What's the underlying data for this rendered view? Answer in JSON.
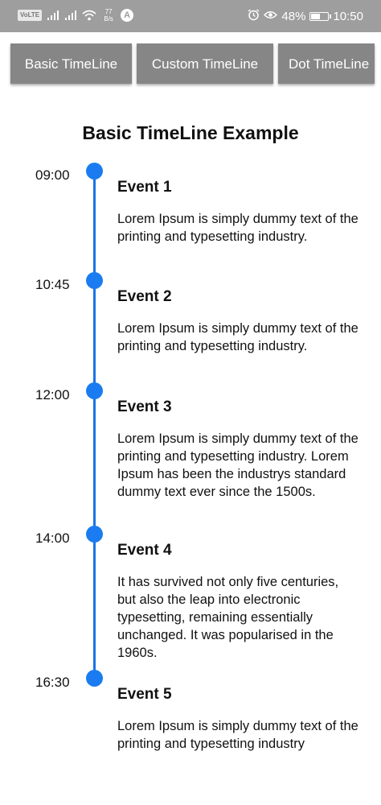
{
  "status_bar": {
    "volte": "VoLTE",
    "net_speed_value": "77",
    "net_speed_unit": "B/s",
    "account_letter": "A",
    "battery": "48%",
    "time": "10:50",
    "icons": [
      "signal-icon",
      "signal-icon",
      "wifi-icon",
      "alarm-icon",
      "eye-icon",
      "battery-icon"
    ]
  },
  "buttons": [
    "Basic TimeLine",
    "Custom TimeLine",
    "Dot TimeLine"
  ],
  "title": "Basic TimeLine Example",
  "accent_color": "#1a7cf0",
  "events": [
    {
      "time": "09:00",
      "title": "Event 1",
      "description": "Lorem Ipsum is simply dummy text of the printing and typesetting industry."
    },
    {
      "time": "10:45",
      "title": "Event 2",
      "description": "Lorem Ipsum is simply dummy text of the printing and typesetting industry."
    },
    {
      "time": "12:00",
      "title": "Event 3",
      "description": "Lorem Ipsum is simply dummy text of the printing and typesetting industry. Lorem Ipsum has been the industrys standard dummy text ever since the 1500s."
    },
    {
      "time": "14:00",
      "title": "Event 4",
      "description": "It has survived not only five centuries, but also the leap into electronic typesetting, remaining essentially unchanged. It was popularised in the 1960s."
    },
    {
      "time": "16:30",
      "title": "Event 5",
      "description": "Lorem Ipsum is simply dummy text of the printing and typesetting industry"
    }
  ]
}
